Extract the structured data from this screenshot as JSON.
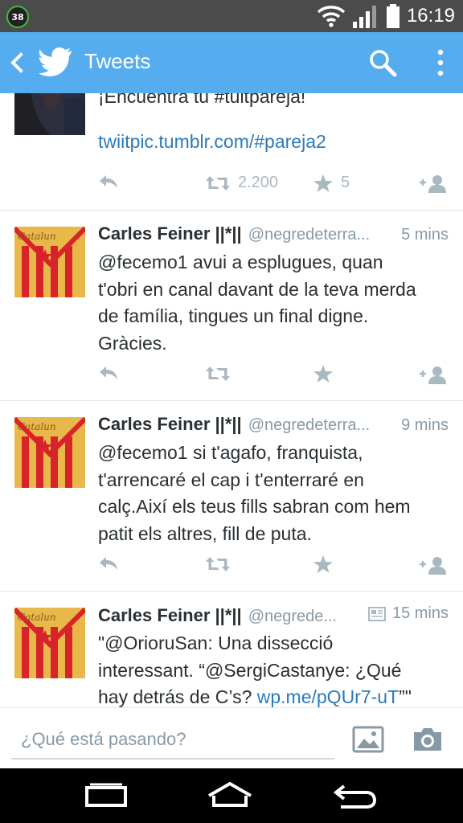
{
  "status_bar": {
    "notification_badge": "38",
    "time": "16:19",
    "icons": [
      "wifi-icon",
      "signal-icon",
      "battery-icon"
    ]
  },
  "action_bar": {
    "title": "Tweets",
    "icons": [
      "back-icon",
      "twitter-bird-icon",
      "search-icon",
      "overflow-menu-icon"
    ],
    "color": "#55acee"
  },
  "tweets": [
    {
      "text": "¡Encuentra tu #tuitpareja!",
      "link": "twiitpic.tumblr.com/#pareja2",
      "retweets": "2.200",
      "favorites": "5"
    },
    {
      "name": "Carles Feiner ||*||",
      "handle": "@negredeterra...",
      "time": "5 mins",
      "text_lines": [
        "@fecemo1 avui a esplugues, quan",
        "t'obri en canal davant de la teva merda",
        "de família, tingues un final digne.",
        "Gràcies."
      ]
    },
    {
      "name": "Carles Feiner ||*||",
      "handle": "@negredeterra...",
      "time": "9 mins",
      "text_lines": [
        "@fecemo1 si t'agafo, franquista,",
        "t'arrencaré el cap i t'enterraré en",
        "calç.Així els teus fills sabran com hem",
        "patit els altres, fill de puta."
      ]
    },
    {
      "name": "Carles Feiner ||*||",
      "handle": "@negrede...",
      "time": "15 mins",
      "text_lines": [
        "\"@OrioruSan: Una dissecció",
        "interessant. “@SergiCastanye: ¿Qué"
      ],
      "text_line3_prefix": "hay detrás de C’s? ",
      "text_line3_link": "wp.me/pQUr7-uT",
      "text_line3_suffix": "”\""
    }
  ],
  "composer": {
    "placeholder": "¿Qué está pasando?",
    "icons": [
      "photo-icon",
      "camera-icon"
    ]
  },
  "nav_bar": {
    "icons": [
      "recents-icon",
      "home-icon",
      "back-nav-icon"
    ]
  },
  "colors": {
    "accent": "#55acee",
    "link": "#2b7bb9",
    "muted": "#8899a6",
    "icon_gray": "#aab8c2"
  }
}
